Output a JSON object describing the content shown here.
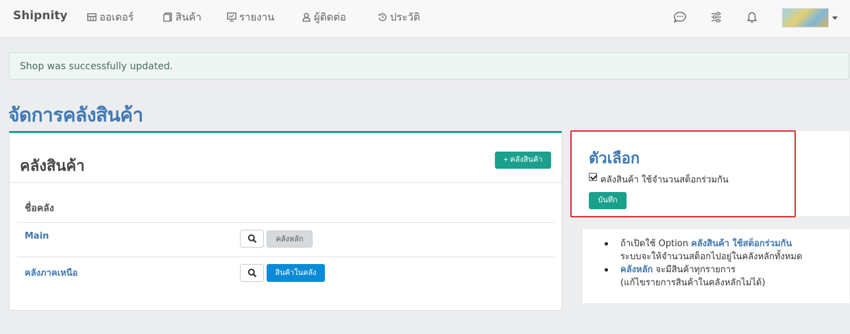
{
  "navbar": {
    "brand": "Shipnity",
    "items": [
      {
        "label": "ออเดอร์",
        "icon": "store-icon"
      },
      {
        "label": "สินค้า",
        "icon": "products-icon"
      },
      {
        "label": "รายงาน",
        "icon": "report-icon"
      },
      {
        "label": "ผู้ติดต่อ",
        "icon": "contacts-icon"
      },
      {
        "label": "ประวัติ",
        "icon": "history-icon"
      }
    ],
    "right_icons": [
      "chat-icon",
      "settings-sliders-icon",
      "bell-icon"
    ],
    "avatar": "avatar"
  },
  "alert": {
    "text": "Shop was successfully updated."
  },
  "page": {
    "title": "จัดการคลังสินค้า"
  },
  "warehouses": {
    "title": "คลังสินค้า",
    "add_button": "+ คลังสินค้า",
    "column_header": "ชื่อคลัง",
    "rows": [
      {
        "name": "Main",
        "action_label": "คลังหลัก"
      },
      {
        "name": "คลังภาคเหนือ",
        "action_label": "สินค้าในคลัง"
      }
    ]
  },
  "options": {
    "title": "ตัวเลือก",
    "checkbox_label": "คลังสินค้า ใช้จำนวนสต็อกร่วมกัน",
    "checked": true,
    "save_button": "บันทึก"
  },
  "info": {
    "item1_prefix": "ถ้าเปิดใช้ Option ",
    "item1_bold": "คลังสินค้า ใช้สต็อกร่วมกัน",
    "item1_line2": "ระบบจะให้จำนวนสต็อกไปอยู่ในคลังหลักทั้งหมด",
    "item2_bold": "คลังหลัก",
    "item2_rest": " จะมีสินค้าทุกรายการ",
    "item2_line2": "(แก้ไขรายการสินค้าในคลังหลักไม่ได้)"
  },
  "colors": {
    "accent": "#1aa08c",
    "title_blue": "#3f78b4",
    "button_blue": "#0a8bd6",
    "highlight_red": "#d93030"
  }
}
